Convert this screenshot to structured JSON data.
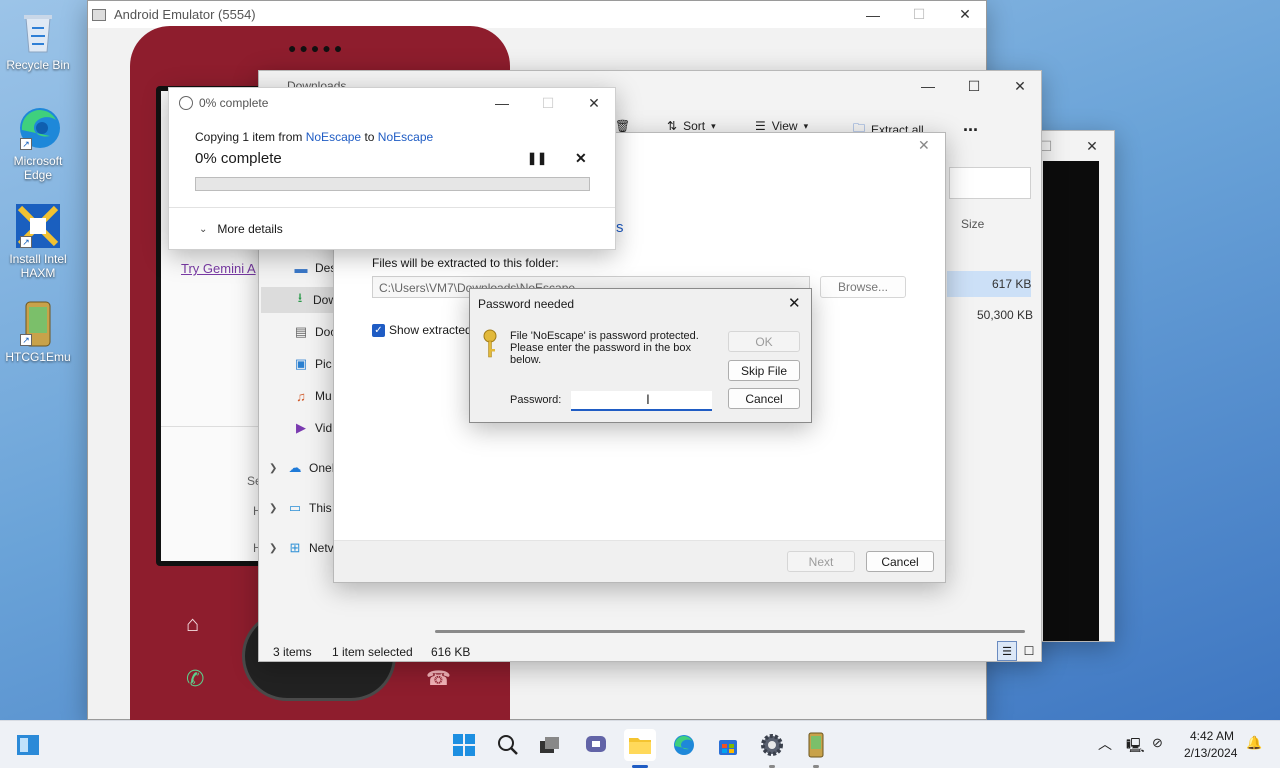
{
  "desktop": {
    "icons": [
      {
        "label": "Recycle Bin"
      },
      {
        "label": "Microsoft Edge"
      },
      {
        "label": "Install Intel HAXM"
      },
      {
        "label": "HTCG1Emu"
      }
    ]
  },
  "emulator": {
    "title": "Android Emulator (5554)"
  },
  "phone": {
    "link_text": "Try Gemini A"
  },
  "explorer": {
    "title": "Downloads",
    "toolbar": {
      "sort": "Sort",
      "view": "View",
      "extract_all": "Extract all",
      "more": "..."
    },
    "nav": [
      "Des",
      "Dow",
      "Doc",
      "Pic",
      "Mu",
      "Vid",
      "OneI",
      "This",
      "Netv"
    ],
    "column_size": "Size",
    "sizes": [
      "617 KB",
      "50,300 KB"
    ],
    "status": {
      "items": "3 items",
      "selected": "1 item selected",
      "selected_size": "616 KB"
    },
    "side_letters": [
      "Se",
      "H",
      "H"
    ]
  },
  "wizard": {
    "folder_label": "Files will be extracted to this folder:",
    "path": "C:\\Users\\VM7\\Downloads\\NoEscape",
    "browse": "Browse...",
    "show_extracted": "Show extracted",
    "next": "Next",
    "cancel": "Cancel",
    "partial_s": "s"
  },
  "password_dialog": {
    "title": "Password needed",
    "message": "File 'NoEscape' is password protected. Please enter the password in the box below.",
    "password_label": "Password:",
    "password_value": "",
    "ok": "OK",
    "skip": "Skip File",
    "cancel": "Cancel"
  },
  "progress_dialog": {
    "title": "0% complete",
    "copy_prefix": "Copying 1 item from",
    "source": "NoEscape",
    "to_word": "to",
    "destination": "NoEscape",
    "headline": "0% complete",
    "progress": 0,
    "more_details": "More details"
  },
  "taskbar": {
    "time": "4:42 AM",
    "date": "2/13/2024"
  },
  "colors": {
    "accent": "#1f5cc4",
    "phone_body": "#8e1d2d"
  }
}
